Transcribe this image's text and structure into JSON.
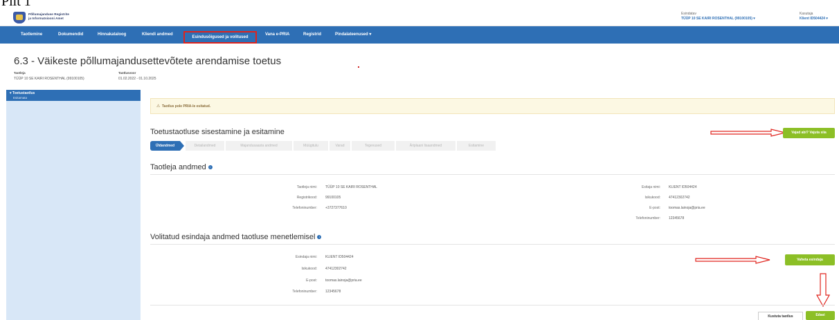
{
  "caption": "Pilt 1",
  "header": {
    "logo_line1": "Põllumajanduse Registrite",
    "logo_line2": "ja Informatsiooni Amet",
    "represented_label": "Esindatav",
    "represented_value": "TÜÜP 10 SE KAIRI ROSENTHAL (99100105) ▾",
    "user_label": "Kasutaja",
    "user_value": "Klient ID504424 ▾"
  },
  "nav": {
    "items": [
      "Taotlemine",
      "Dokumendid",
      "Hinnakataloog",
      "Kliendi andmed",
      "Esindusõigused ja volitused",
      "Vana e-PRIA",
      "Registrid",
      "Pindalateenused ▾"
    ]
  },
  "page": {
    "title": "6.3 - Väikeste põllumajandusettevõtete arendamise toetus",
    "applicant_label": "Taotleja",
    "applicant_value": "TÜÜP 10 SE KAIRI ROSENTHAL (99100105)",
    "round_label": "Taotlusvoor",
    "round_value": "01.02.2022 - 01.10.2025"
  },
  "sidebar": {
    "item_label": "▾ Toetustaotlus",
    "sub_label": "Esitamata"
  },
  "alert": {
    "text": "Taotlus pole PRIA-le esitatud."
  },
  "section_main": {
    "title": "Toetustaotluse sisestamine ja esitamine",
    "help_button": "Vajad abi? Vajuta siia"
  },
  "steps": [
    "Üldandmed",
    "Detailandmed",
    "Majandusaasta andmed",
    "Müügitulu",
    "Varad",
    "Tegevused",
    "Äriplaani lisaandmed",
    "Esitamine"
  ],
  "applicant": {
    "title": "Taotleja andmed",
    "fields": [
      {
        "label": "Taotleja nimi:",
        "value": "TÜÜP 10 SE KAIRI ROSENTHAL"
      },
      {
        "label": "Registrikood:",
        "value": "99100105"
      },
      {
        "label": "Telefoninumber:",
        "value": "+3727377610"
      }
    ],
    "submitter_fields": [
      {
        "label": "Esitaja nimi:",
        "value": "KLIENT ID504424"
      },
      {
        "label": "Isikukood:",
        "value": "47412302742"
      },
      {
        "label": "E-post:",
        "value": "toomas.lainoja@pria.ee"
      },
      {
        "label": "Telefoninumber:",
        "value": "12345678"
      }
    ]
  },
  "representative": {
    "title": "Volitatud esindaja andmed taotluse menetlemisel",
    "fields": [
      {
        "label": "Esindaja nimi:",
        "value": "KLIENT ID504424"
      },
      {
        "label": "Isikukood:",
        "value": "47412302742"
      },
      {
        "label": "E-post:",
        "value": "toomas.lainoja@pria.ee"
      },
      {
        "label": "Telefoninumber:",
        "value": "12345678"
      }
    ],
    "change_button": "Vaheta esindaja"
  },
  "footer": {
    "delete_button": "Kustuta taotlus",
    "next_button": "Edasi"
  },
  "colors": {
    "primary": "#2e6fb5",
    "accent_green": "#8cbf26",
    "annotation_red": "#e0231c"
  }
}
